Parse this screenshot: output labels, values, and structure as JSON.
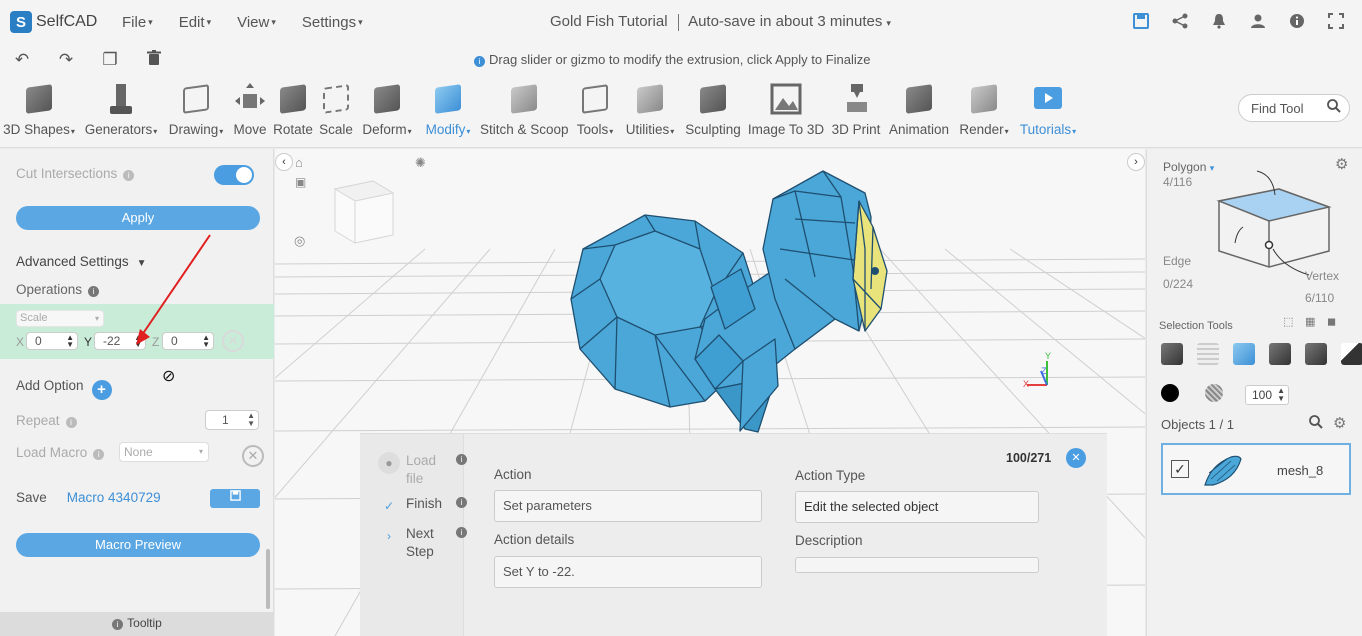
{
  "app": {
    "name": "SelfCAD",
    "logo_letter": "S"
  },
  "menu": [
    "File",
    "Edit",
    "View",
    "Settings"
  ],
  "document": {
    "title": "Gold Fish Tutorial",
    "autosave": "Auto-save in about 3 minutes"
  },
  "hint": "Drag slider or gizmo to modify the extrusion, click Apply to Finalize",
  "toolbar": {
    "tools": [
      "3D Shapes",
      "Generators",
      "Drawing",
      "Move",
      "Rotate",
      "Scale",
      "Deform",
      "Modify",
      "Stitch & Scoop",
      "Tools",
      "Utilities",
      "Sculpting",
      "Image To 3D",
      "3D Print",
      "Animation",
      "Render",
      "Tutorials"
    ],
    "find_tool": "Find Tool"
  },
  "left_panel": {
    "cut_intersections": "Cut Intersections",
    "apply": "Apply",
    "advanced_settings": "Advanced Settings",
    "operations": "Operations",
    "op_type": "Scale",
    "x_label": "X",
    "x_value": "0",
    "y_label": "Y",
    "y_value": "-22",
    "z_label": "Z",
    "z_value": "0",
    "add_option": "Add Option",
    "repeat": "Repeat",
    "repeat_value": "1",
    "load_macro": "Load Macro",
    "load_macro_value": "None",
    "save": "Save",
    "macro_name": "Macro 4340729",
    "macro_preview": "Macro Preview",
    "tooltip": "Tooltip"
  },
  "macro_dialog": {
    "steps": [
      "Load file",
      "Finish",
      "Next Step"
    ],
    "counter": "100/271",
    "action_label": "Action",
    "action_value": "Set parameters",
    "action_details_label": "Action details",
    "action_details_value": "Set Y to -22.",
    "action_type_label": "Action Type",
    "action_type_value": "Edit the selected object",
    "description_label": "Description",
    "description_value": ""
  },
  "right_panel": {
    "mode": "Polygon",
    "polygon_count": "4/116",
    "edge_label": "Edge",
    "edge_count": "0/224",
    "vertex_label": "Vertex",
    "vertex_count": "6/110",
    "selection_tools": "Selection Tools",
    "opacity": "100",
    "objects_header": "Objects 1 / 1",
    "object_name": "mesh_8"
  },
  "colors": {
    "accent": "#4a9de0",
    "fish_blue": "#4aa7d8",
    "highlight_face": "#e8e37a",
    "green_zone": "#c9ecd9"
  }
}
